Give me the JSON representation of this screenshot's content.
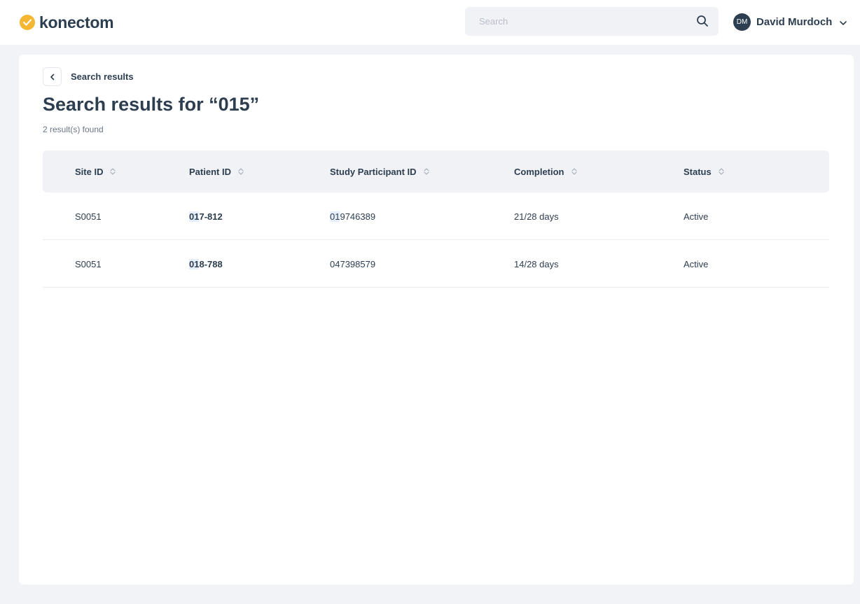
{
  "app": {
    "brand": "konectom"
  },
  "search": {
    "placeholder": "Search",
    "value": ""
  },
  "user": {
    "initials": "DM",
    "name": "David Murdoch"
  },
  "breadcrumb": {
    "label": "Search results"
  },
  "page": {
    "title": "Search results for “015”",
    "count": "2 result(s) found"
  },
  "table": {
    "headers": [
      "Site ID",
      "Patient ID",
      "Study Participant ID",
      "Completion",
      "Status"
    ],
    "rows": [
      {
        "site_id": "S0051",
        "patient_id_hl": "01",
        "patient_id_rest": "7-812",
        "participant_hl": "01",
        "participant_rest": "9746389",
        "completion": "21/28 days",
        "status": "Active"
      },
      {
        "site_id": "S0051",
        "patient_id_hl": "01",
        "patient_id_rest": "8-788",
        "participant_hl": "",
        "participant_rest": "047398579",
        "completion": "14/28 days",
        "status": "Active"
      }
    ]
  },
  "colors": {
    "brand_accent": "#f5b731",
    "text_primary": "#2c3e50",
    "highlight": "#e6eefb",
    "surface_muted": "#f1f2f6"
  },
  "icons": {
    "logo": "check-circle-icon",
    "search": "search-icon",
    "user_menu": "chevron-down-icon",
    "back": "chevron-left-icon",
    "sort": "sort-icon"
  }
}
